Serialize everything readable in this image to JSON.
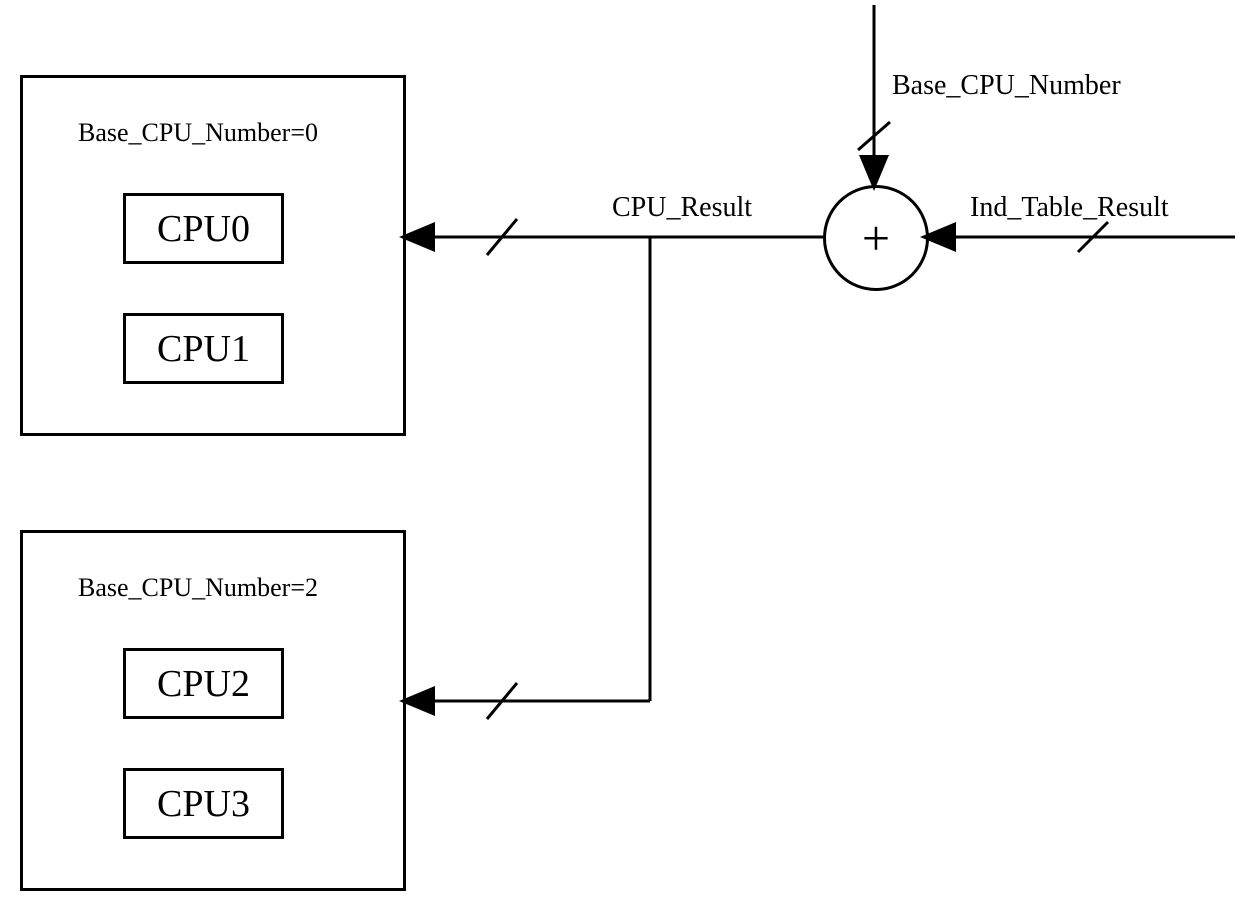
{
  "groups": [
    {
      "label": "Base_CPU_Number=0",
      "cpus": [
        "CPU0",
        "CPU1"
      ]
    },
    {
      "label": "Base_CPU_Number=2",
      "cpus": [
        "CPU2",
        "CPU3"
      ]
    }
  ],
  "adder_symbol": "+",
  "signals": {
    "base_cpu_number": "Base_CPU_Number",
    "cpu_result": "CPU_Result",
    "ind_table_result": "Ind_Table_Result"
  }
}
